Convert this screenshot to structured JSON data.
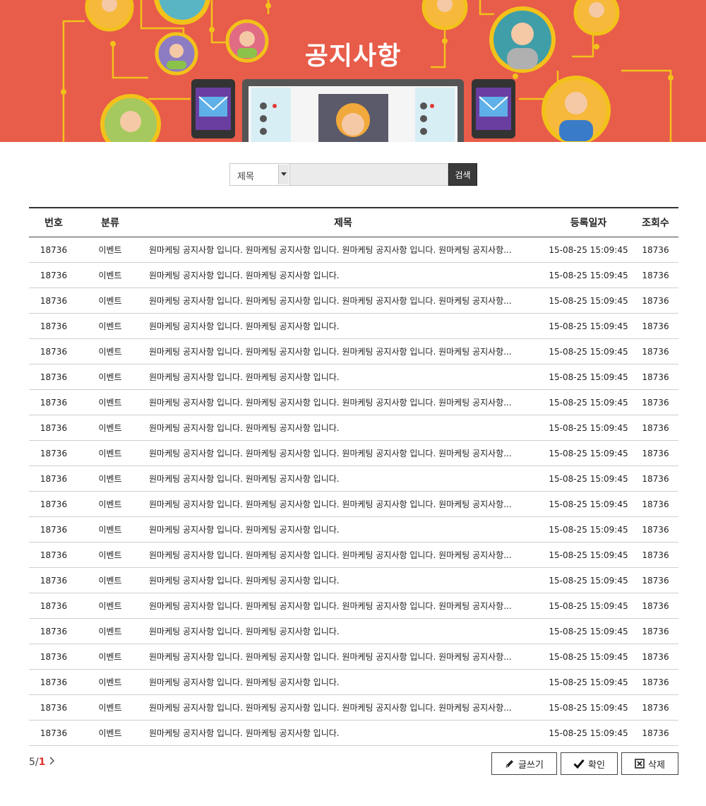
{
  "banner": {
    "title": "공지사항"
  },
  "search": {
    "select_value": "제목",
    "input_placeholder": "",
    "button_label": "검색"
  },
  "table": {
    "headers": {
      "num": "번호",
      "category": "분류",
      "title": "제목",
      "date": "등록일자",
      "views": "조회수"
    },
    "rows": [
      {
        "num": "18736",
        "category": "이벤트",
        "title": "원마케팅 공지사항 입니다. 원마케팅 공지사항 입니다. 원마케팅 공지사항 입니다. 원마케팅 공지사항...",
        "date": "15-08-25 15:09:45",
        "views": "18736"
      },
      {
        "num": "18736",
        "category": "이벤트",
        "title": "원마케팅 공지사항 입니다. 원마케팅 공지사항 입니다.",
        "date": "15-08-25 15:09:45",
        "views": "18736"
      },
      {
        "num": "18736",
        "category": "이벤트",
        "title": "원마케팅 공지사항 입니다. 원마케팅 공지사항 입니다. 원마케팅 공지사항 입니다. 원마케팅 공지사항...",
        "date": "15-08-25 15:09:45",
        "views": "18736"
      },
      {
        "num": "18736",
        "category": "이벤트",
        "title": "원마케팅 공지사항 입니다. 원마케팅 공지사항 입니다.",
        "date": "15-08-25 15:09:45",
        "views": "18736"
      },
      {
        "num": "18736",
        "category": "이벤트",
        "title": "원마케팅 공지사항 입니다. 원마케팅 공지사항 입니다. 원마케팅 공지사항 입니다. 원마케팅 공지사항...",
        "date": "15-08-25 15:09:45",
        "views": "18736"
      },
      {
        "num": "18736",
        "category": "이벤트",
        "title": "원마케팅 공지사항 입니다. 원마케팅 공지사항 입니다.",
        "date": "15-08-25 15:09:45",
        "views": "18736"
      },
      {
        "num": "18736",
        "category": "이벤트",
        "title": "원마케팅 공지사항 입니다. 원마케팅 공지사항 입니다. 원마케팅 공지사항 입니다. 원마케팅 공지사항...",
        "date": "15-08-25 15:09:45",
        "views": "18736"
      },
      {
        "num": "18736",
        "category": "이벤트",
        "title": "원마케팅 공지사항 입니다. 원마케팅 공지사항 입니다.",
        "date": "15-08-25 15:09:45",
        "views": "18736"
      },
      {
        "num": "18736",
        "category": "이벤트",
        "title": "원마케팅 공지사항 입니다. 원마케팅 공지사항 입니다. 원마케팅 공지사항 입니다. 원마케팅 공지사항...",
        "date": "15-08-25 15:09:45",
        "views": "18736"
      },
      {
        "num": "18736",
        "category": "이벤트",
        "title": "원마케팅 공지사항 입니다. 원마케팅 공지사항 입니다.",
        "date": "15-08-25 15:09:45",
        "views": "18736"
      },
      {
        "num": "18736",
        "category": "이벤트",
        "title": "원마케팅 공지사항 입니다. 원마케팅 공지사항 입니다. 원마케팅 공지사항 입니다. 원마케팅 공지사항...",
        "date": "15-08-25 15:09:45",
        "views": "18736"
      },
      {
        "num": "18736",
        "category": "이벤트",
        "title": "원마케팅 공지사항 입니다. 원마케팅 공지사항 입니다.",
        "date": "15-08-25 15:09:45",
        "views": "18736"
      },
      {
        "num": "18736",
        "category": "이벤트",
        "title": "원마케팅 공지사항 입니다. 원마케팅 공지사항 입니다. 원마케팅 공지사항 입니다. 원마케팅 공지사항...",
        "date": "15-08-25 15:09:45",
        "views": "18736"
      },
      {
        "num": "18736",
        "category": "이벤트",
        "title": "원마케팅 공지사항 입니다. 원마케팅 공지사항 입니다.",
        "date": "15-08-25 15:09:45",
        "views": "18736"
      },
      {
        "num": "18736",
        "category": "이벤트",
        "title": "원마케팅 공지사항 입니다. 원마케팅 공지사항 입니다. 원마케팅 공지사항 입니다. 원마케팅 공지사항...",
        "date": "15-08-25 15:09:45",
        "views": "18736"
      },
      {
        "num": "18736",
        "category": "이벤트",
        "title": "원마케팅 공지사항 입니다. 원마케팅 공지사항 입니다.",
        "date": "15-08-25 15:09:45",
        "views": "18736"
      },
      {
        "num": "18736",
        "category": "이벤트",
        "title": "원마케팅 공지사항 입니다. 원마케팅 공지사항 입니다. 원마케팅 공지사항 입니다. 원마케팅 공지사항...",
        "date": "15-08-25 15:09:45",
        "views": "18736"
      },
      {
        "num": "18736",
        "category": "이벤트",
        "title": "원마케팅 공지사항 입니다. 원마케팅 공지사항 입니다.",
        "date": "15-08-25 15:09:45",
        "views": "18736"
      },
      {
        "num": "18736",
        "category": "이벤트",
        "title": "원마케팅 공지사항 입니다. 원마케팅 공지사항 입니다. 원마케팅 공지사항 입니다. 원마케팅 공지사항...",
        "date": "15-08-25 15:09:45",
        "views": "18736"
      },
      {
        "num": "18736",
        "category": "이벤트",
        "title": "원마케팅 공지사항 입니다. 원마케팅 공지사항 입니다.",
        "date": "15-08-25 15:09:45",
        "views": "18736"
      }
    ]
  },
  "pagination": {
    "total": "5",
    "separator": "/",
    "current": "1",
    "next_icon": "chevron-right-icon"
  },
  "actions": {
    "write_label": "글쓰기",
    "write_icon": "pencil-icon",
    "ok_label": "확인",
    "ok_icon": "check-icon",
    "delete_label": "삭제",
    "delete_icon": "close-box-icon"
  },
  "colors": {
    "banner_bg": "#e85c4a",
    "accent_red": "#e0322a",
    "search_button": "#3a3a3a"
  }
}
